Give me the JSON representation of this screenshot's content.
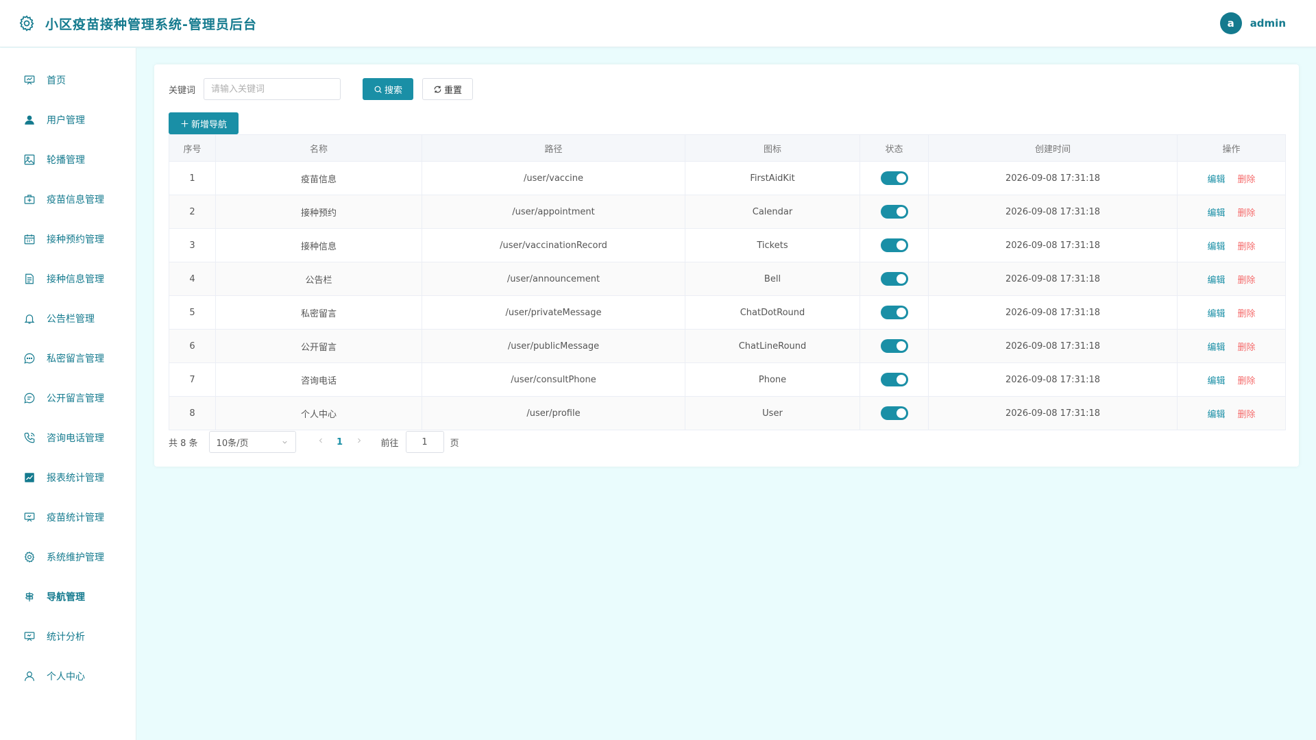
{
  "header": {
    "title": "小区疫苗接种管理系统-管理员后台",
    "avatar_letter": "a",
    "username": "admin"
  },
  "sidebar": {
    "items": [
      {
        "label": "首页",
        "icon": "dashboard-icon"
      },
      {
        "label": "用户管理",
        "icon": "user-filled-icon"
      },
      {
        "label": "轮播管理",
        "icon": "picture-icon"
      },
      {
        "label": "疫苗信息管理",
        "icon": "first-aid-kit-icon"
      },
      {
        "label": "接种预约管理",
        "icon": "calendar-icon"
      },
      {
        "label": "接种信息管理",
        "icon": "document-icon"
      },
      {
        "label": "公告栏管理",
        "icon": "bell-icon"
      },
      {
        "label": "私密留言管理",
        "icon": "chat-dot-icon"
      },
      {
        "label": "公开留言管理",
        "icon": "chat-line-icon"
      },
      {
        "label": "咨询电话管理",
        "icon": "phone-icon"
      },
      {
        "label": "报表统计管理",
        "icon": "chart-icon"
      },
      {
        "label": "疫苗统计管理",
        "icon": "presentation-icon"
      },
      {
        "label": "系统维护管理",
        "icon": "gear-icon"
      },
      {
        "label": "导航管理",
        "icon": "guide-icon"
      },
      {
        "label": "统计分析",
        "icon": "presentation-icon"
      },
      {
        "label": "个人中心",
        "icon": "user-icon"
      }
    ]
  },
  "search": {
    "label": "关键词",
    "placeholder": "请输入关键词",
    "value": "",
    "search_label": "搜索",
    "reset_label": "重置"
  },
  "toolbar": {
    "add_label": "新增导航"
  },
  "table": {
    "columns": [
      "序号",
      "名称",
      "路径",
      "图标",
      "状态",
      "创建时间",
      "操作"
    ],
    "edit_label": "编辑",
    "delete_label": "删除",
    "rows": [
      {
        "index": "1",
        "name": "疫苗信息",
        "path": "/user/vaccine",
        "icon": "FirstAidKit",
        "enabled": true,
        "created": "2026-09-08 17:31:18"
      },
      {
        "index": "2",
        "name": "接种预约",
        "path": "/user/appointment",
        "icon": "Calendar",
        "enabled": true,
        "created": "2026-09-08 17:31:18"
      },
      {
        "index": "3",
        "name": "接种信息",
        "path": "/user/vaccinationRecord",
        "icon": "Tickets",
        "enabled": true,
        "created": "2026-09-08 17:31:18"
      },
      {
        "index": "4",
        "name": "公告栏",
        "path": "/user/announcement",
        "icon": "Bell",
        "enabled": true,
        "created": "2026-09-08 17:31:18"
      },
      {
        "index": "5",
        "name": "私密留言",
        "path": "/user/privateMessage",
        "icon": "ChatDotRound",
        "enabled": true,
        "created": "2026-09-08 17:31:18"
      },
      {
        "index": "6",
        "name": "公开留言",
        "path": "/user/publicMessage",
        "icon": "ChatLineRound",
        "enabled": true,
        "created": "2026-09-08 17:31:18"
      },
      {
        "index": "7",
        "name": "咨询电话",
        "path": "/user/consultPhone",
        "icon": "Phone",
        "enabled": true,
        "created": "2026-09-08 17:31:18"
      },
      {
        "index": "8",
        "name": "个人中心",
        "path": "/user/profile",
        "icon": "User",
        "enabled": true,
        "created": "2026-09-08 17:31:18"
      }
    ]
  },
  "pager": {
    "total_text": "共 8 条",
    "page_size": "10条/页",
    "current_page": "1",
    "goto_label": "前往",
    "goto_value": "1",
    "page_suffix": "页"
  },
  "colors": {
    "primary": "#1a8fa6",
    "brand_text": "#147a8e",
    "danger": "#f56c6c",
    "background": "#eafcfd"
  }
}
